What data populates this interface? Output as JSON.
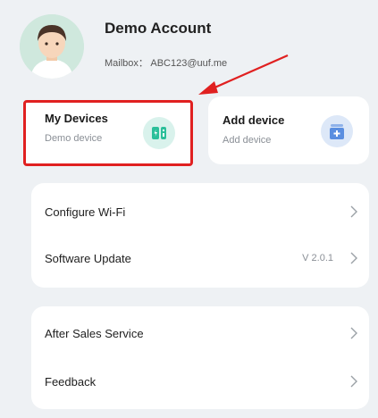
{
  "profile": {
    "account_name": "Demo Account",
    "mailbox": "Mailbox： ABC123@uuf.me"
  },
  "cards": {
    "my_devices": {
      "title": "My Devices",
      "subtitle": "Demo device",
      "icon": "device-icon"
    },
    "add_device": {
      "title": "Add device",
      "subtitle": "Add device",
      "icon": "add-box-icon"
    }
  },
  "menu_group_1": [
    {
      "label": "Configure Wi-Fi",
      "value": ""
    },
    {
      "label": "Software Update",
      "value": "V 2.0.1"
    }
  ],
  "menu_group_2": [
    {
      "label": "After Sales Service",
      "value": ""
    },
    {
      "label": "Feedback",
      "value": ""
    }
  ],
  "colors": {
    "background": "#eef1f4",
    "highlight": "#e02020",
    "device_icon": "#2bbf9a",
    "add_icon": "#5a8ee0"
  }
}
